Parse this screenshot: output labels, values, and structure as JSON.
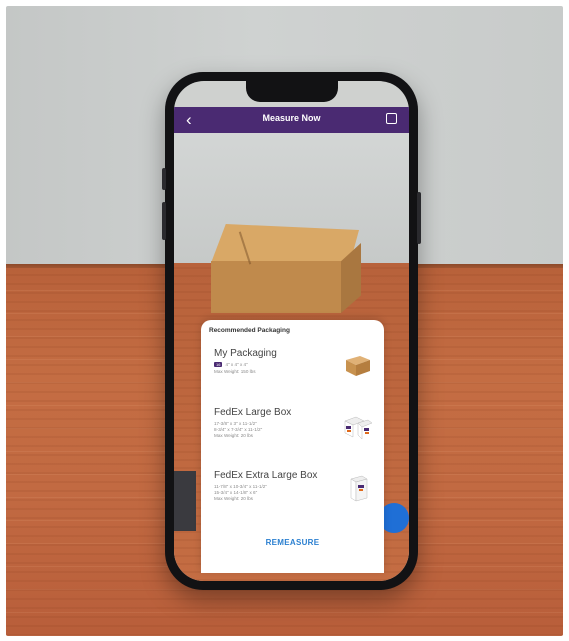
{
  "header": {
    "back_icon": "chevron-left-icon",
    "title": "Measure Now",
    "action_icon": "share-box-icon"
  },
  "sheet": {
    "title": "Recommended Packaging",
    "items": [
      {
        "name": "My Packaging",
        "tag": "16",
        "dims": "4\" x 4\" x 4\"",
        "weight": "Max Weight: 150 lbs",
        "icon": "cardboard-box-icon"
      },
      {
        "name": "FedEx Large Box",
        "dims": "17-3/8\" x 3\" x 11-1/2\"",
        "dims2": "8-3/4\" x 7-3/4\" x 11-1/2\"",
        "weight": "Max Weight: 20 lbs",
        "icon": "fedex-large-box-icon"
      },
      {
        "name": "FedEx Extra Large Box",
        "dims": "11-7/8\" x 10-3/4\" x 11-1/2\"",
        "dims2": "15-3/4\" x 14-1/8\" x 6\"",
        "weight": "Max Weight: 20 lbs",
        "icon": "fedex-extra-large-box-icon"
      }
    ],
    "action_label": "REMEASURE"
  },
  "colors": {
    "brand_purple": "#4a2a72",
    "action_blue": "#2a7fd0"
  }
}
